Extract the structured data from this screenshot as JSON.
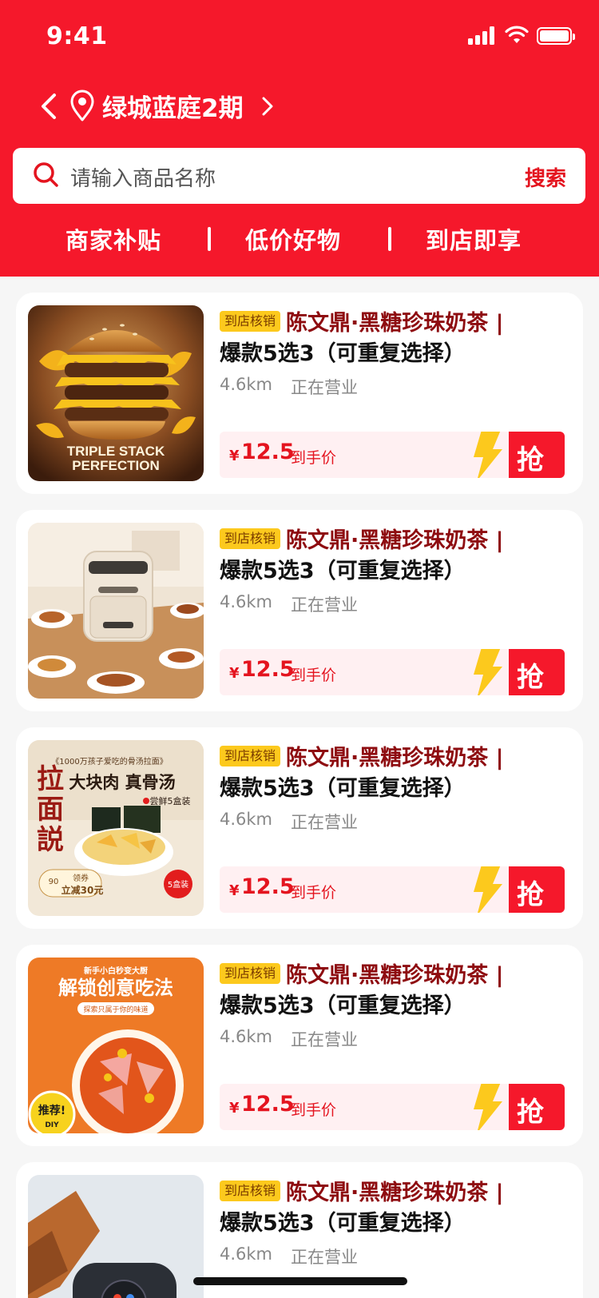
{
  "status_bar": {
    "time": "9:41"
  },
  "header": {
    "location": "绿城蓝庭2期",
    "search_placeholder": "请输入商品名称",
    "search_button": "搜索",
    "tabs": [
      "商家补贴",
      "低价好物",
      "到店即享"
    ]
  },
  "images": {
    "burger": {
      "caption": "TRIPLE STACK PERFECTION"
    },
    "noodle": {
      "brand": "拉面説",
      "tagline": "《1000万孩子爱吃的骨汤拉面》",
      "headline": "大块肉 真骨汤",
      "sub": "尝鲜5盒装",
      "coupon_label": "领券",
      "coupon_value": "立减30元",
      "coupon_amount": "90",
      "box_label": "5盒装"
    },
    "diy": {
      "top": "新手小白秒变大厨",
      "headline": "解锁创意吃法",
      "sub": "探索只属于你的味道",
      "badge": "推荐!",
      "badge_sub": "DIY"
    }
  },
  "products": [
    {
      "badge": "到店核销",
      "title_line1": "陈文鼎·黑糖珍珠奶茶 |",
      "title_line2": "爆款5选3（可重复选择）",
      "distance": "4.6km",
      "status": "正在营业",
      "currency": "¥",
      "price": "12.5",
      "price_label": "到手价",
      "cta": "抢",
      "image": "burger-image"
    },
    {
      "badge": "到店核销",
      "title_line1": "陈文鼎·黑糖珍珠奶茶 |",
      "title_line2": "爆款5选3（可重复选择）",
      "distance": "4.6km",
      "status": "正在营业",
      "currency": "¥",
      "price": "12.5",
      "price_label": "到手价",
      "cta": "抢",
      "image": "air-fryer-image"
    },
    {
      "badge": "到店核销",
      "title_line1": "陈文鼎·黑糖珍珠奶茶 |",
      "title_line2": "爆款5选3（可重复选择）",
      "distance": "4.6km",
      "status": "正在营业",
      "currency": "¥",
      "price": "12.5",
      "price_label": "到手价",
      "cta": "抢",
      "image": "ramen-image"
    },
    {
      "badge": "到店核销",
      "title_line1": "陈文鼎·黑糖珍珠奶茶 |",
      "title_line2": "爆款5选3（可重复选择）",
      "distance": "4.6km",
      "status": "正在营业",
      "currency": "¥",
      "price": "12.5",
      "price_label": "到手价",
      "cta": "抢",
      "image": "diy-noodle-image"
    },
    {
      "badge": "到店核销",
      "title_line1": "陈文鼎·黑糖珍珠奶茶 |",
      "title_line2": "爆款5选3（可重复选择）",
      "distance": "4.6km",
      "status": "正在营业",
      "image": "coffee-machine-image"
    }
  ],
  "colors": {
    "brand_red": "#f5182b",
    "price_red": "#e4141f",
    "title_dark_red": "#8e0c10",
    "badge_yellow": "#fcc91d",
    "background": "#f6f6f6"
  }
}
